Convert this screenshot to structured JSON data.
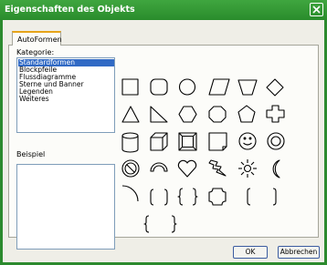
{
  "window": {
    "title": "Eigenschaften des Objekts"
  },
  "tabs": [
    {
      "label": "AutoFormen"
    }
  ],
  "category": {
    "label": "Kategorie:",
    "items": [
      "Standardformen",
      "Blockpfeile",
      "Flussdiagramme",
      "Sterne und Banner",
      "Legenden",
      "Weiteres"
    ],
    "selected": "Standardformen"
  },
  "preview": {
    "label": "Beispiel"
  },
  "buttons": {
    "ok": "OK",
    "cancel": "Abbrechen"
  },
  "shapes": [
    [
      "rectangle-shape",
      "rounded-rectangle-shape",
      "ellipse-shape",
      "parallelogram-shape",
      "trapezoid-shape",
      "diamond-shape"
    ],
    [
      "triangle-shape",
      "right-triangle-shape",
      "hexagon-shape",
      "octagon-shape",
      "pentagon-shape",
      "cross-shape"
    ],
    [
      "can-shape",
      "cube-shape",
      "bevel-shape",
      "folded-corner-shape",
      "smiley-face-shape",
      "donut-shape"
    ],
    [
      "no-symbol-shape",
      "block-arc-shape",
      "heart-shape",
      "lightning-bolt-shape",
      "sun-shape",
      "moon-shape"
    ],
    [
      "arc-shape",
      "double-bracket-shape",
      "double-brace-shape",
      "plaque-shape",
      "left-bracket-shape",
      "right-bracket-shape"
    ],
    [
      "left-brace-shape",
      "right-brace-shape"
    ]
  ],
  "colors": {
    "title_bar": "#2a8c2c",
    "selection": "#316ac5",
    "tab_accent": "#e6a419"
  }
}
